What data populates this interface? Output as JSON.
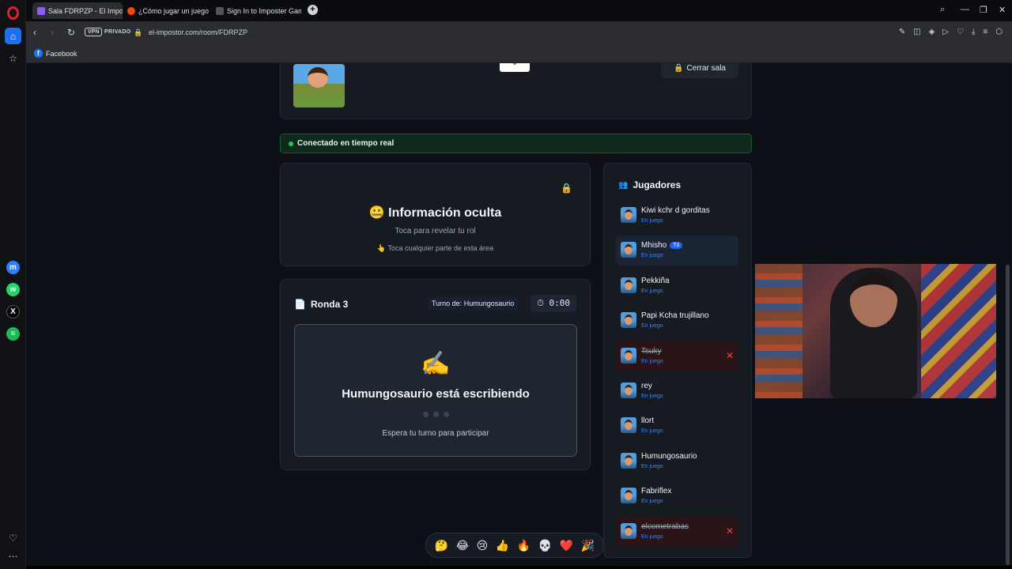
{
  "browser": {
    "tabs": [
      {
        "label": "Sala FDRPZP - El Impostor",
        "active": true
      },
      {
        "label": "¿Cómo jugar un juego típico",
        "active": false
      },
      {
        "label": "Sign In to Imposter Game",
        "active": false
      }
    ],
    "vpn_label": "VPN",
    "private_label": "PRIVADO",
    "url": "el-impostor.com/room/FDRPZP",
    "bookmarks": [
      {
        "label": "Facebook"
      }
    ]
  },
  "room": {
    "close_label": "Cerrar sala",
    "connection_status": "Conectado en tiempo real"
  },
  "hidden_info": {
    "emoji": "🤐",
    "title": "Información oculta",
    "subtitle": "Toca para revelar tu rol",
    "hint_emoji": "👆",
    "hint": "Toca cualquier parte de esta área"
  },
  "round": {
    "emoji": "📄",
    "title": "Ronda 3",
    "turn_label": "Turno de: Humungosaurio",
    "timer": "0:00",
    "typing_title": "Humungosaurio está escribiendo",
    "wait_text": "Espera tu turno para participar"
  },
  "players_panel": {
    "title": "Jugadores",
    "you_badge": "Tú",
    "players": [
      {
        "name": "Kiwi kchr d gorditas",
        "status": "En juego",
        "me": false,
        "eliminated": false
      },
      {
        "name": "Mhisho",
        "status": "En juego",
        "me": true,
        "eliminated": false
      },
      {
        "name": "Pekkiña",
        "status": "En juego",
        "me": false,
        "eliminated": false
      },
      {
        "name": "Papi Kcha trujillano",
        "status": "En juego",
        "me": false,
        "eliminated": false
      },
      {
        "name": "Tsuky",
        "status": "En juego",
        "me": false,
        "eliminated": true
      },
      {
        "name": "rey",
        "status": "En juego",
        "me": false,
        "eliminated": false
      },
      {
        "name": "llort",
        "status": "En juego",
        "me": false,
        "eliminated": false
      },
      {
        "name": "Humungosaurio",
        "status": "En juego",
        "me": false,
        "eliminated": false
      },
      {
        "name": "Fabriflex",
        "status": "En juego",
        "me": false,
        "eliminated": false
      },
      {
        "name": "elcometrabas",
        "status": "En juego",
        "me": false,
        "eliminated": true
      }
    ]
  },
  "reactions": [
    "🤔",
    "😂",
    "😢",
    "👍",
    "🔥",
    "💀",
    "❤️",
    "🎉"
  ],
  "colors": {
    "accent": "#2563eb",
    "live": "#22c55e",
    "danger": "#ef4444"
  }
}
